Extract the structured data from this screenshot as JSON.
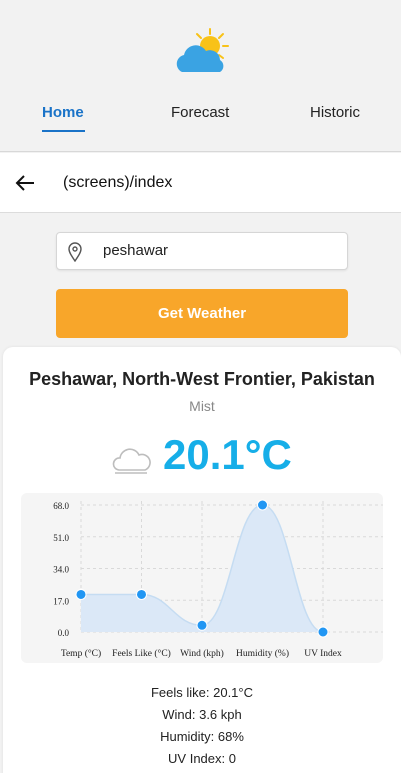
{
  "nav": {
    "tabs": [
      {
        "label": "Home",
        "active": true
      },
      {
        "label": "Forecast",
        "active": false
      },
      {
        "label": "Historic",
        "active": false
      }
    ],
    "accent": "#1a73c8"
  },
  "header": {
    "title": "(screens)/index",
    "back_icon": "arrow-left-icon"
  },
  "search": {
    "value": "peshawar",
    "icon": "map-pin-icon"
  },
  "button": {
    "label": "Get Weather",
    "color": "#f8a62a"
  },
  "weather": {
    "location": "Peshawar, North-West Frontier, Pakistan",
    "condition": "Mist",
    "temperature": "20.1°C",
    "temp_color": "#16aee8",
    "details": {
      "feels_like": "Feels like: 20.1°C",
      "wind": "Wind: 3.6 kph",
      "humidity": "Humidity: 68%",
      "uv": "UV Index: 0"
    }
  },
  "chart_data": {
    "type": "area",
    "categories": [
      "Temp (°C)",
      "Feels Like (°C)",
      "Wind (kph)",
      "Humidity (%)",
      "UV Index"
    ],
    "values": [
      20.1,
      20.1,
      3.6,
      68,
      0
    ],
    "yticks": [
      "68.0",
      "51.0",
      "34.0",
      "17.0",
      "0.0"
    ],
    "ylim": [
      0,
      68
    ],
    "grid": true,
    "line_color": "#c5dcf2",
    "fill_color": "#dbe8f7",
    "point_color": "#2196f3"
  }
}
